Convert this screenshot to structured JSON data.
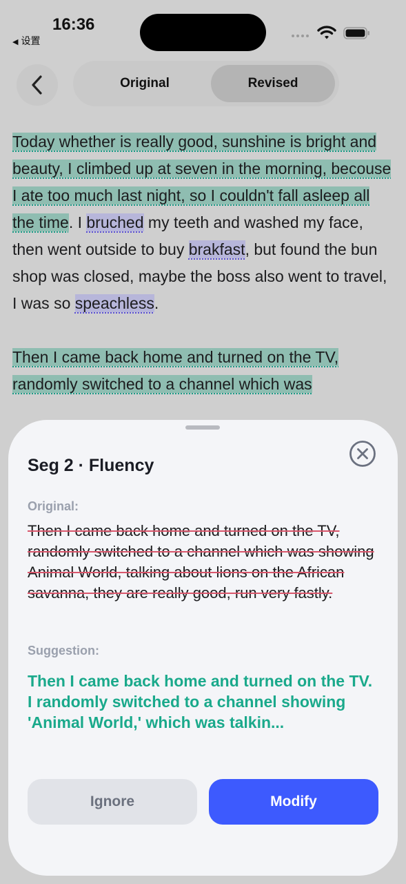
{
  "status_bar": {
    "time": "16:36",
    "back_app": "设置"
  },
  "nav": {
    "tabs": [
      {
        "label": "Original"
      },
      {
        "label": "Revised",
        "selected": true
      }
    ]
  },
  "essay": {
    "paragraph1": {
      "seg1": "Today whether is really good, sunshine is bright and beauty, I climbed up at seven in the morning, becouse I ate too much last night, so I couldn't fall asleep all the time",
      "t1": ". I ",
      "w1": "bruched",
      "t2": " my teeth and washed my face, then went outside to buy ",
      "w2": "brakfast",
      "t3": ", but found the bun shop was closed, maybe the boss also went to travel, I was so ",
      "w3": "speachless",
      "t4": "."
    },
    "paragraph2": {
      "seg2": "Then I came back home and turned on the TV, randomly switched to a channel which was"
    }
  },
  "sheet": {
    "title": "Seg 2 · Fluency",
    "original_label": "Original:",
    "original_text": "Then I came back home and turned on the TV, randomly switched to a channel which was showing Animal World, talking about lions on the African savanna, they are really good, run very fastly.",
    "suggestion_label": "Suggestion:",
    "suggestion_text": "Then I came back home and turned on the TV. I randomly switched to a channel showing 'Animal World,' which was talkin...",
    "ignore_label": "Ignore",
    "modify_label": "Modify"
  },
  "colors": {
    "accent": "#3d5afe",
    "suggestion": "#1aa98b",
    "strike": "#d9566b",
    "highlight_fluency": "#8fbdb1",
    "highlight_spelling": "#b7b6da"
  }
}
